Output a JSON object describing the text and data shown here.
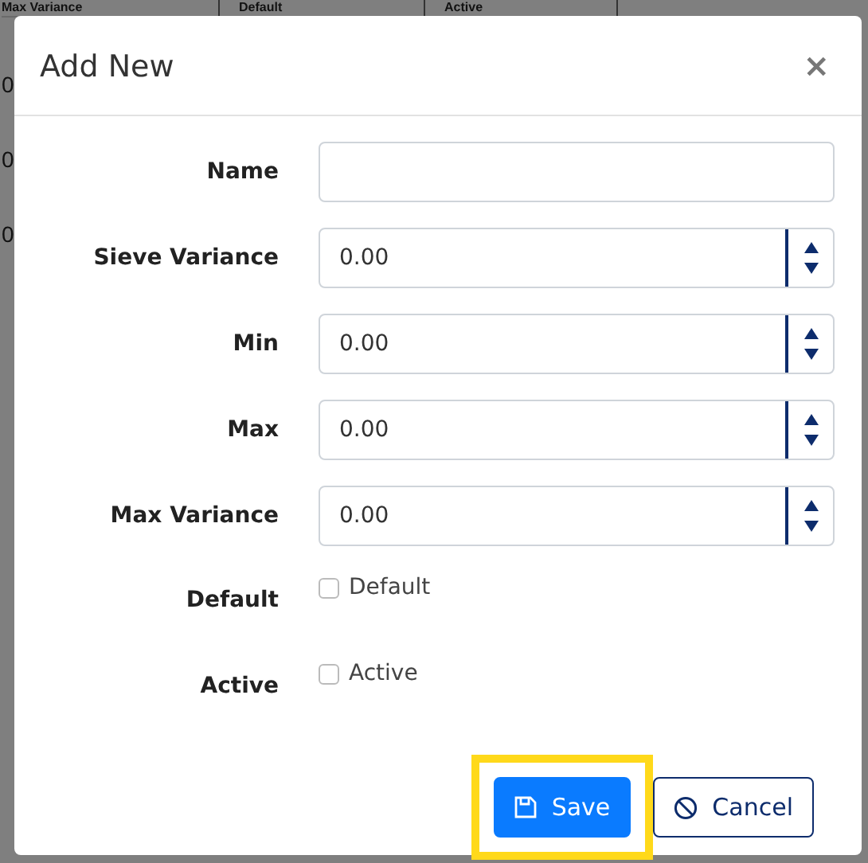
{
  "background_table": {
    "columns": [
      "Max Variance",
      "Default",
      "Active"
    ],
    "rows": [
      {
        "column_1": "0"
      },
      {
        "column_1": "0"
      },
      {
        "column_1": "0"
      }
    ]
  },
  "dialog": {
    "title": "Add New",
    "close": "×",
    "fields": [
      {
        "kind": "text",
        "label": "Name"
      },
      {
        "kind": "number",
        "label": "Sieve Variance",
        "value": "0.00"
      },
      {
        "kind": "number",
        "label": "Min",
        "value": "0.00"
      },
      {
        "kind": "number",
        "label": "Max",
        "value": "0.00"
      },
      {
        "kind": "number",
        "label": "Max Variance",
        "value": "0.00"
      },
      {
        "kind": "checkbox",
        "label": "Default",
        "option": "Default",
        "checked": false
      },
      {
        "kind": "checkbox",
        "label": "Active",
        "option": "Active",
        "checked": false
      }
    ],
    "buttons": [
      {
        "kind": "primary",
        "label": "Save",
        "highlighted": true
      },
      {
        "kind": "secondary",
        "label": "Cancel",
        "highlighted": false
      }
    ]
  }
}
